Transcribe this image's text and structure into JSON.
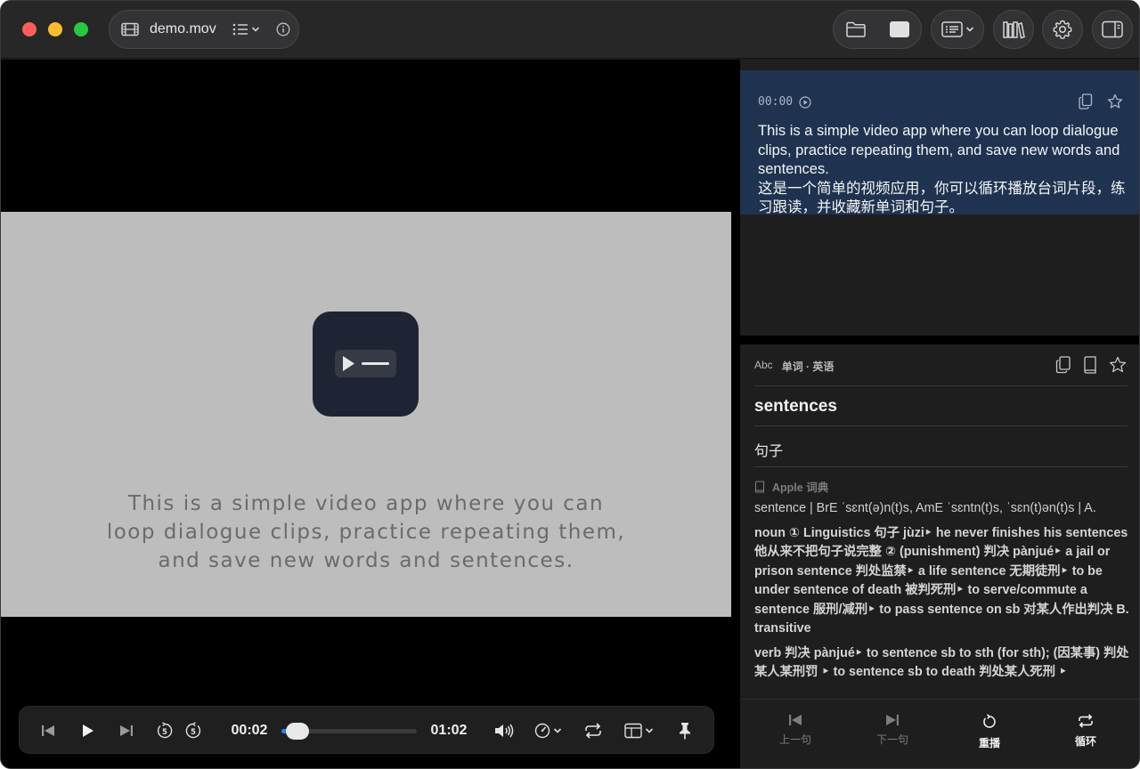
{
  "window": {
    "file_name": "demo.mov"
  },
  "video": {
    "caption": "This is a simple video app where you can\nloop dialogue clips, practice repeating them,\nand save new words and sentences.",
    "controls": {
      "current_time": "00:02",
      "duration": "01:02",
      "progress": 0.03,
      "replay_back_seconds": "5",
      "replay_forward_seconds": "5"
    }
  },
  "subtitle": {
    "timestamp": "00:00",
    "text_en": "This is a simple video app where you can loop dialogue clips, practice repeating them, and save new words and sentences.",
    "text_zh": "这是一个简单的视频应用，你可以循环播放台词片段，练习跟读，并收藏新单词和句子。"
  },
  "dictionary": {
    "abc_label": "Abc",
    "header": "单词 · 英语",
    "word": "sentences",
    "translation": "句子",
    "source": "Apple 词典",
    "pronunciation": "sentence | BrE ˈsɛnt(ə)n(t)s, AmE ˈsɛntn(t)s, ˈsɛn(t)ən(t)s | A.",
    "definition_noun": "noun ① Linguistics 句子 jùzi‣ he never finishes his sentences 他从来不把句子说完整 ② (punishment) 判决 pànjué‣ a jail or prison sentence 判处监禁‣ a life sentence 无期徒刑‣ to be under sentence of death 被判死刑‣ to serve/commute a sentence 服刑/减刑‣ to pass sentence on sb 对某人作出判决 B. transitive",
    "definition_verb": "verb 判决 pànjué‣ to sentence sb to sth (for sth); (因某事) 判处某人某刑罚 ‣ to sentence sb to death 判处某人死刑 ‣",
    "footer": {
      "prev": "上一句",
      "next": "下一句",
      "replay": "重播",
      "loop": "循环"
    }
  }
}
